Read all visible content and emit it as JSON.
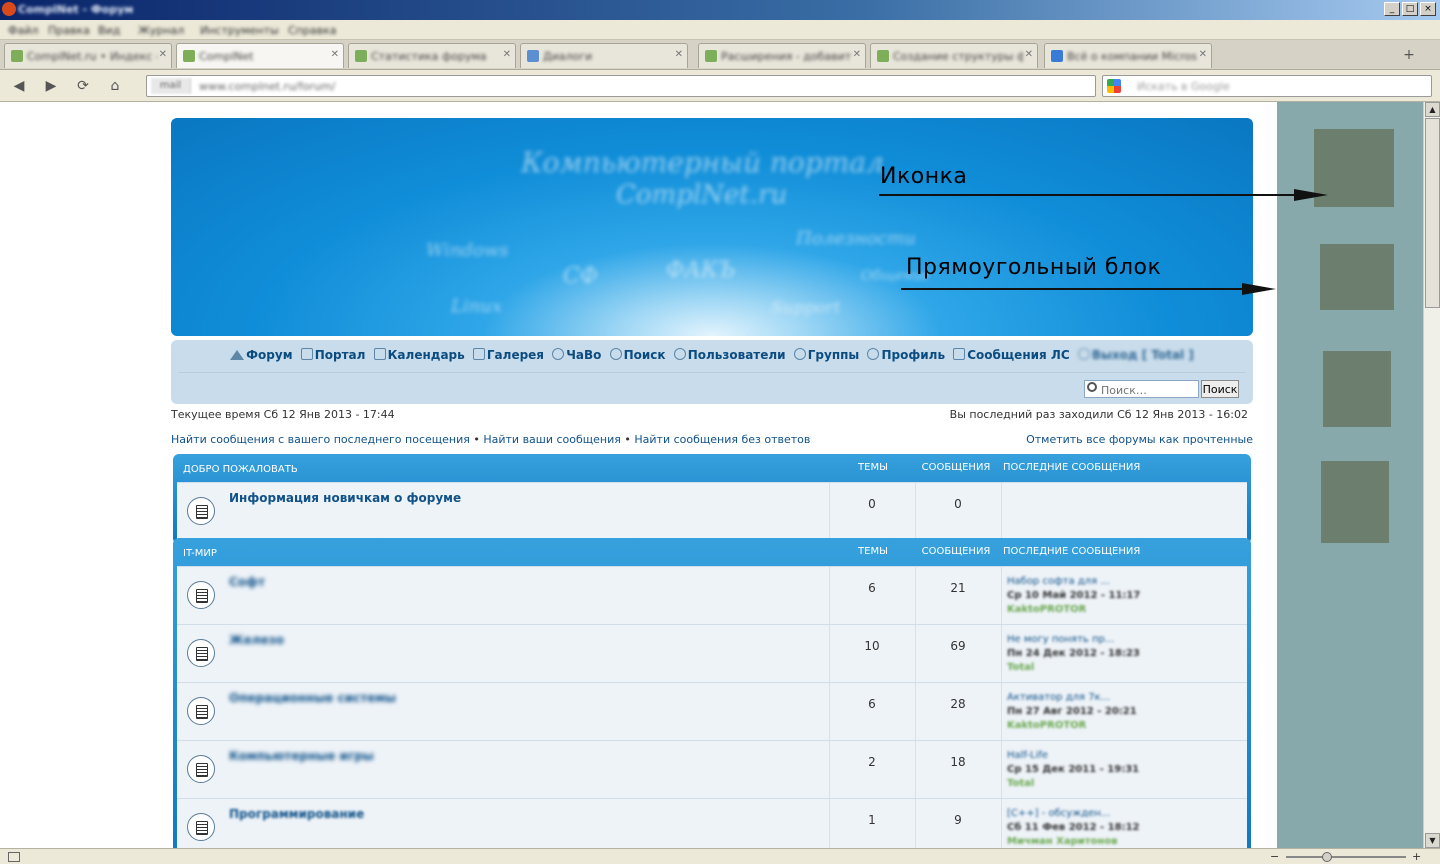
{
  "browser": {
    "title": "ComplNet - Форум",
    "menu": [
      "Файл",
      "Правка",
      "Вид",
      "Журнал",
      "Инструменты",
      "Справка"
    ],
    "tabs": [
      {
        "label": "ComplNet.ru • Индекс форума",
        "active": false
      },
      {
        "label": "ComplNet",
        "active": true
      },
      {
        "label": "Статистика форума",
        "active": false
      },
      {
        "label": "Диалоги",
        "active": false
      },
      {
        "label": "Расширения - добавить",
        "active": false
      },
      {
        "label": "Создание структуры форума",
        "active": false
      },
      {
        "label": "Всё о компании Microsoft",
        "active": false
      }
    ],
    "url": "www.complnet.ru/forum/",
    "site_badge": "mail",
    "search_placeholder": "Искать в Google"
  },
  "forum": {
    "banner_scribbles": [
      "Компьютерный портал",
      "ComplNet.ru",
      "Windows",
      "Linux",
      "СФ",
      "ФАКЪ",
      "Полезности",
      "Support",
      "Общение"
    ],
    "nav": [
      {
        "label": "Форум",
        "icon": "home-icon"
      },
      {
        "label": "Портал",
        "icon": "portal-icon"
      },
      {
        "label": "Календарь",
        "icon": "calendar-icon"
      },
      {
        "label": "Галерея",
        "icon": "gallery-icon"
      },
      {
        "label": "ЧаВо",
        "icon": "faq-icon"
      },
      {
        "label": "Поиск",
        "icon": "search-icon"
      },
      {
        "label": "Пользователи",
        "icon": "user-icon"
      },
      {
        "label": "Группы",
        "icon": "group-icon"
      },
      {
        "label": "Профиль",
        "icon": "profile-icon"
      },
      {
        "label": "Сообщения ЛС",
        "icon": "mail-icon"
      },
      {
        "label": "Выход [ Total ]",
        "icon": "logout-icon"
      }
    ],
    "search_placeholder": "Поиск…",
    "search_button": "Поиск",
    "current_time": "Текущее время Сб 12 Янв 2013 - 17:44",
    "last_visit": "Вы последний раз заходили Сб 12 Янв 2013 - 16:02",
    "link_new_posts": "Найти сообщения с вашего последнего посещения",
    "link_your_posts": "Найти ваши сообщения",
    "link_unanswered": "Найти сообщения без ответов",
    "bullet": "•",
    "mark_all_read": "Отметить все форумы как прочтенные",
    "columns": {
      "topics": "ТЕМЫ",
      "posts": "СООБЩЕНИЯ",
      "last": "ПОСЛЕДНИЕ СООБЩЕНИЯ"
    },
    "categories": [
      {
        "title": "ДОБРО ПОЖАЛОВАТЬ",
        "rows": [
          {
            "title": "Информация новичкам о форуме",
            "topics": "0",
            "posts": "0",
            "last_title": "",
            "last_date": "",
            "last_user": ""
          }
        ]
      },
      {
        "title": "IT-МИР",
        "rows": [
          {
            "title": "Софт",
            "topics": "6",
            "posts": "21",
            "last_title": "Набор софта для ...",
            "last_date": "Ср 10 Май 2012 - 11:17",
            "last_user": "KaktoPROTOR"
          },
          {
            "title": "Железо",
            "topics": "10",
            "posts": "69",
            "last_title": "Не могу понять пр...",
            "last_date": "Пн 24 Дек 2012 - 18:23",
            "last_user": "Total"
          },
          {
            "title": "Операционные системы",
            "topics": "6",
            "posts": "28",
            "last_title": "Активатор для 7к...",
            "last_date": "Пн 27 Авг 2012 - 20:21",
            "last_user": "KaktoPROTOR"
          },
          {
            "title": "Компьютерные игры",
            "topics": "2",
            "posts": "18",
            "last_title": "Half-Life",
            "last_date": "Ср 15 Дек 2011 - 19:31",
            "last_user": "Total"
          },
          {
            "title": "Программирование",
            "topics": "1",
            "posts": "9",
            "last_title": "[C++] - обсужден...",
            "last_date": "Сб 11 Фев 2012 - 18:12",
            "last_user": "Мичман Харитонов"
          }
        ]
      }
    ]
  },
  "annotations": {
    "icon_label": "Иконка",
    "block_label": "Прямоугольный блок"
  },
  "colors": {
    "banner": "#108dd8",
    "panel": "#88a9ac",
    "square": "#6c7f6e",
    "link": "#105289"
  }
}
